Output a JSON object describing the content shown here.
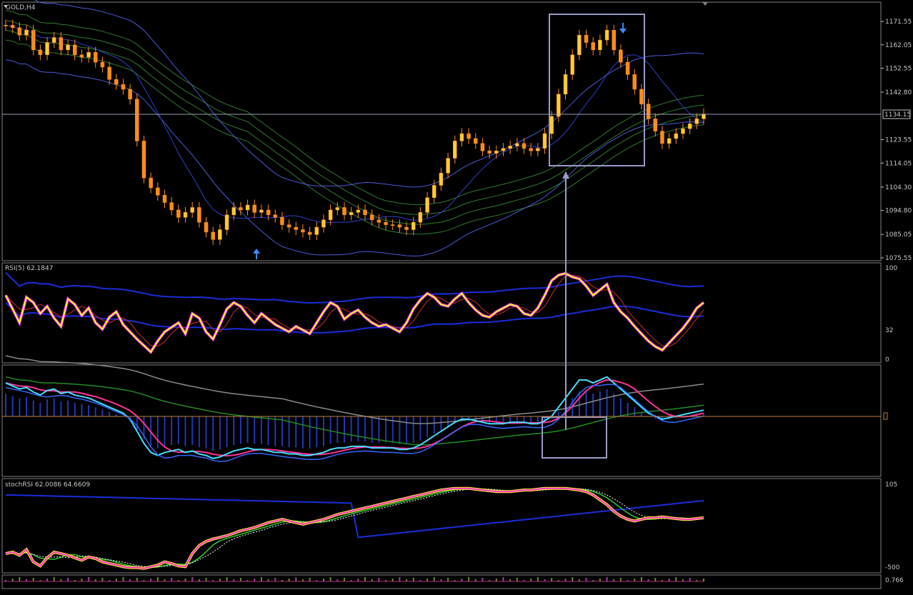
{
  "window": {
    "symbol_label": "GOLD,H4",
    "current_price_label": "1134.15"
  },
  "panels": {
    "price": {
      "title": "GOLD,H4",
      "ticks": [
        "1171.55",
        "1162.05",
        "1152.55",
        "1142.80",
        "1134.15",
        "1123.55",
        "1114.05",
        "1104.30",
        "1094.80",
        "1085.05",
        "1075.55"
      ]
    },
    "rsi": {
      "title": "RSI(5) 62.1847",
      "ticks": [
        "100",
        "32",
        "0"
      ]
    },
    "macd": {
      "title": "",
      "ticks": []
    },
    "stochrsi": {
      "title": "stochRSI 62.0086 64.6609",
      "ticks": [
        "105",
        "-500"
      ]
    },
    "bottom": {
      "title": "",
      "ticks": [
        "0.766"
      ]
    }
  },
  "chart_data": [
    {
      "type": "candlestick",
      "title": "GOLD,H4",
      "ylim": [
        1075.55,
        1171.55
      ],
      "current_price": 1134.15,
      "close_series": [
        1170,
        1169,
        1166,
        1168,
        1160,
        1158,
        1163,
        1165,
        1160,
        1162,
        1158,
        1157,
        1159,
        1155,
        1153,
        1148,
        1146,
        1144,
        1140,
        1123,
        1108,
        1104,
        1101,
        1098,
        1095,
        1092,
        1094,
        1096,
        1090,
        1086,
        1083,
        1087,
        1093,
        1096,
        1095,
        1097,
        1094,
        1095,
        1093,
        1092,
        1089,
        1088,
        1087,
        1086,
        1085,
        1088,
        1091,
        1095,
        1096,
        1093,
        1094,
        1095,
        1093,
        1091,
        1090,
        1089,
        1089,
        1088,
        1087,
        1090,
        1094,
        1100,
        1105,
        1110,
        1116,
        1123,
        1126,
        1124,
        1122,
        1119,
        1118,
        1119,
        1120,
        1121,
        1122,
        1120,
        1119,
        1120,
        1126,
        1133,
        1142,
        1150,
        1158,
        1166,
        1163,
        1160,
        1164,
        1168,
        1160,
        1155,
        1150,
        1144,
        1138,
        1132,
        1127,
        1122,
        1124,
        1126,
        1128,
        1130,
        1132,
        1134
      ]
    },
    {
      "type": "line",
      "title": "RSI(5) 62.1847",
      "ylim": [
        0,
        100
      ],
      "current": 62.1847,
      "values": [
        70,
        55,
        40,
        68,
        62,
        50,
        58,
        45,
        36,
        66,
        60,
        48,
        56,
        40,
        33,
        46,
        52,
        38,
        30,
        22,
        15,
        8,
        20,
        30,
        35,
        40,
        28,
        50,
        45,
        30,
        22,
        38,
        55,
        62,
        58,
        48,
        40,
        50,
        44,
        38,
        34,
        30,
        36,
        32,
        28,
        40,
        52,
        62,
        58,
        44,
        50,
        54,
        46,
        40,
        36,
        38,
        34,
        30,
        40,
        55,
        65,
        72,
        68,
        60,
        58,
        66,
        72,
        62,
        54,
        48,
        46,
        52,
        56,
        60,
        58,
        50,
        48,
        56,
        70,
        86,
        92,
        94,
        90,
        88,
        80,
        70,
        76,
        82,
        62,
        52,
        45,
        36,
        28,
        20,
        14,
        10,
        18,
        26,
        34,
        44,
        56,
        62
      ]
    },
    {
      "type": "line",
      "title": "",
      "series_count": 4,
      "values": [
        60,
        58,
        56,
        57,
        54,
        52,
        55,
        56,
        53,
        54,
        52,
        51,
        50,
        48,
        46,
        44,
        42,
        40,
        36,
        28,
        20,
        14,
        12,
        14,
        15,
        16,
        14,
        15,
        13,
        12,
        10,
        11,
        13,
        15,
        16,
        17,
        16,
        16,
        15,
        14,
        14,
        13,
        13,
        12,
        12,
        13,
        14,
        16,
        17,
        17,
        18,
        18,
        18,
        17,
        17,
        17,
        17,
        16,
        16,
        17,
        19,
        22,
        25,
        28,
        31,
        34,
        36,
        36,
        35,
        34,
        33,
        33,
        33,
        34,
        34,
        34,
        33,
        33,
        35,
        38,
        44,
        50,
        56,
        62,
        62,
        60,
        62,
        64,
        60,
        56,
        52,
        48,
        44,
        40,
        38,
        36,
        37,
        38,
        39,
        40,
        41,
        42
      ]
    },
    {
      "type": "line",
      "title": "stochRSI 62.0086 64.6609",
      "ylim": [
        -500,
        105
      ],
      "values": [
        20,
        22,
        18,
        25,
        10,
        5,
        15,
        22,
        20,
        18,
        15,
        12,
        16,
        14,
        10,
        8,
        6,
        4,
        3,
        3,
        2,
        4,
        6,
        10,
        8,
        5,
        4,
        20,
        30,
        35,
        38,
        40,
        42,
        45,
        48,
        50,
        52,
        55,
        58,
        60,
        62,
        60,
        58,
        56,
        58,
        60,
        62,
        65,
        68,
        70,
        72,
        74,
        76,
        78,
        80,
        82,
        84,
        86,
        88,
        90,
        92,
        94,
        96,
        98,
        99,
        100,
        100,
        100,
        99,
        98,
        97,
        96,
        96,
        96,
        97,
        98,
        98,
        99,
        100,
        100,
        100,
        100,
        99,
        98,
        96,
        92,
        86,
        80,
        72,
        66,
        62,
        60,
        62,
        64,
        64,
        65,
        64,
        63,
        62,
        62,
        63,
        64
      ]
    }
  ]
}
